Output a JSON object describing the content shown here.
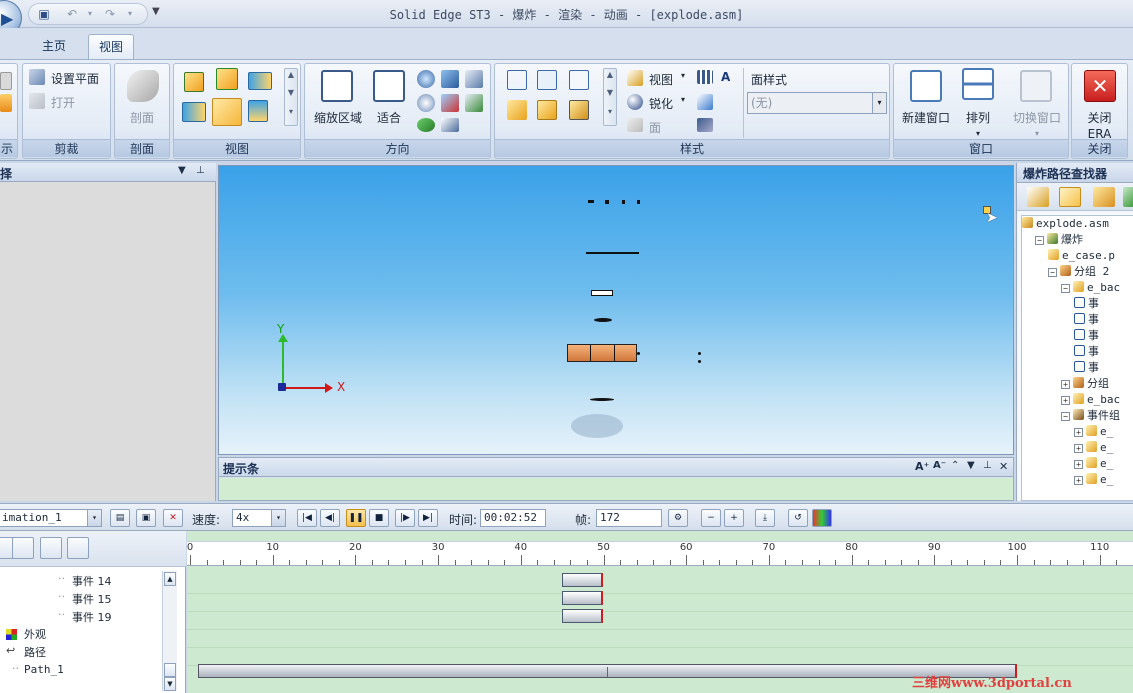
{
  "window": {
    "title": "Solid Edge ST3 - 爆炸 - 渲染 - 动画 - [explode.asm]"
  },
  "tabs": [
    {
      "label": "主页"
    },
    {
      "label": "视图"
    }
  ],
  "ribbon": {
    "groups": {
      "display": {
        "label": "示"
      },
      "clip": {
        "label": "剪裁",
        "set_plane": "设置平面",
        "open": "打开"
      },
      "section": {
        "label": "剖面",
        "section_btn": "剖面"
      },
      "views": {
        "label": "视图"
      },
      "orient": {
        "label": "方向",
        "zoom_area": "缩放区域",
        "fit": "适合"
      },
      "style": {
        "label": "样式",
        "view_style": "视图",
        "sharpen": "锐化",
        "face": "面",
        "face_style_label": "面样式",
        "face_style_value": "(无)"
      },
      "window": {
        "label": "窗口",
        "new_window": "新建窗口",
        "arrange": "排列",
        "switch_window": "切换窗口"
      },
      "close": {
        "label": "关闭",
        "close_era": "关闭",
        "close_era_2": "ERA"
      }
    }
  },
  "left_panel": {
    "title": "择"
  },
  "viewport": {
    "axis_y": "Y",
    "axis_x": "X"
  },
  "hint_bar": {
    "title": "提示条"
  },
  "right_panel": {
    "title": "爆炸路径查找器",
    "tree": [
      {
        "label": "explode.asm",
        "indent": 0,
        "icon": "assembly-icon",
        "expander": ""
      },
      {
        "label": "爆炸",
        "indent": 1,
        "icon": "explode-icon",
        "expander": "−"
      },
      {
        "label": "e_case.p",
        "indent": 2,
        "icon": "part-icon",
        "expander": ""
      },
      {
        "label": "分组 2",
        "indent": 2,
        "icon": "group-icon",
        "expander": "−"
      },
      {
        "label": "e_bac",
        "indent": 3,
        "icon": "part-icon",
        "expander": "−"
      },
      {
        "label": "事",
        "indent": 4,
        "icon": "event-icon",
        "expander": ""
      },
      {
        "label": "事",
        "indent": 4,
        "icon": "event-icon",
        "expander": ""
      },
      {
        "label": "事",
        "indent": 4,
        "icon": "event-icon",
        "expander": ""
      },
      {
        "label": "事",
        "indent": 4,
        "icon": "event-icon",
        "expander": ""
      },
      {
        "label": "事",
        "indent": 4,
        "icon": "event-icon",
        "expander": ""
      },
      {
        "label": "分组",
        "indent": 3,
        "icon": "group-icon",
        "expander": "+"
      },
      {
        "label": "e_bac",
        "indent": 3,
        "icon": "part-icon",
        "expander": "+"
      },
      {
        "label": "事件组",
        "indent": 3,
        "icon": "event-group-icon",
        "expander": "−"
      },
      {
        "label": "e_",
        "indent": 4,
        "icon": "part-icon",
        "expander": "+"
      },
      {
        "label": "e_",
        "indent": 4,
        "icon": "part-icon",
        "expander": "+"
      },
      {
        "label": "e_",
        "indent": 4,
        "icon": "part-icon",
        "expander": "+"
      },
      {
        "label": "e_",
        "indent": 4,
        "icon": "part-icon",
        "expander": "+"
      }
    ]
  },
  "animation": {
    "name": "imation_1",
    "speed_label": "速度:",
    "speed_value": "4x",
    "time_label": "时间:",
    "time_value": "00:02:52",
    "frame_label": "帧:",
    "frame_value": "172"
  },
  "timeline": {
    "events": [
      {
        "label": "事件 14"
      },
      {
        "label": "事件 15"
      },
      {
        "label": "事件 19"
      }
    ],
    "appearance_label": "外观",
    "path_label": "路径",
    "path_item": "Path_1",
    "ruler_ticks": [
      "0",
      "10",
      "20",
      "30",
      "40",
      "50",
      "60",
      "70",
      "80",
      "90",
      "100",
      "110"
    ],
    "event_bars": [
      {
        "start": 45,
        "end": 50
      },
      {
        "start": 45,
        "end": 50
      },
      {
        "start": 45,
        "end": 50
      }
    ],
    "path_bar": {
      "start": 1,
      "end": 100
    }
  },
  "watermark": "三维网www.3dportal.cn"
}
